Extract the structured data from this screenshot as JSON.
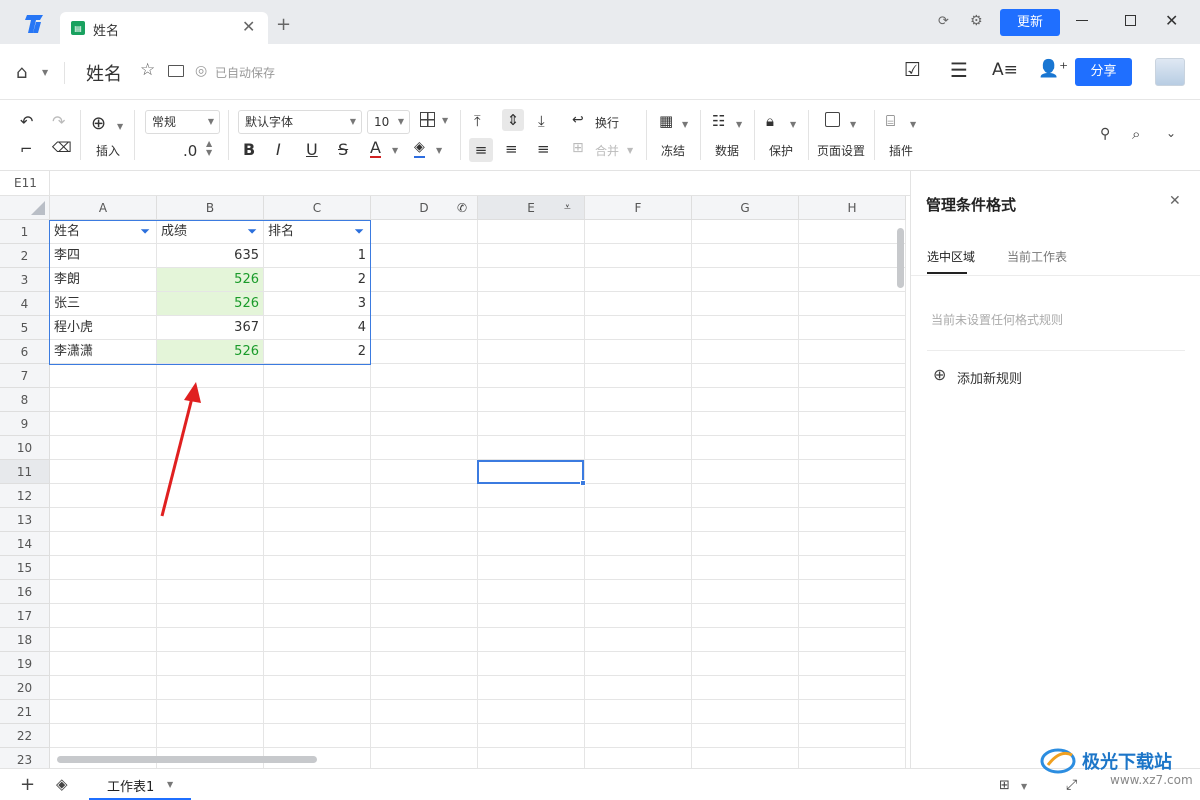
{
  "tabbar": {
    "doc_tab_title": "姓名",
    "new_tab": "+",
    "update_label": "更新"
  },
  "header": {
    "doc_title": "姓名",
    "autosave_text": "已自动保存",
    "share_label": "分享"
  },
  "toolbar": {
    "insert_label": "插入",
    "number_format": "常规",
    "decimal": ".0",
    "font_name": "默认字体",
    "font_size": "10",
    "wrap_label": "换行",
    "merge_label": "合并",
    "freeze_label": "冻结",
    "data_label": "数据",
    "protect_label": "保护",
    "page_setup_label": "页面设置",
    "plugin_label": "插件"
  },
  "formula": {
    "cell_ref": "E11"
  },
  "columns": [
    "A",
    "B",
    "C",
    "D",
    "E",
    "F",
    "G",
    "H"
  ],
  "rows": [
    "1",
    "2",
    "3",
    "4",
    "5",
    "6",
    "7",
    "8",
    "9",
    "10",
    "11",
    "12",
    "13",
    "14",
    "15",
    "16",
    "17",
    "18",
    "19",
    "20",
    "21",
    "22",
    "23"
  ],
  "table": {
    "headers": [
      "姓名",
      "成绩",
      "排名"
    ],
    "rows": [
      {
        "name": "李四",
        "score": "635",
        "rank": "1",
        "highlight": false
      },
      {
        "name": "李朗",
        "score": "526",
        "rank": "2",
        "highlight": true
      },
      {
        "name": "张三",
        "score": "526",
        "rank": "3",
        "highlight": true
      },
      {
        "name": "程小虎",
        "score": "367",
        "rank": "4",
        "highlight": false
      },
      {
        "name": "李潇潇",
        "score": "526",
        "rank": "2",
        "highlight": true
      }
    ]
  },
  "panel": {
    "title": "管理条件格式",
    "tab_selection": "选中区域",
    "tab_sheet": "当前工作表",
    "empty_text": "当前未设置任何格式规则",
    "add_rule": "添加新规则"
  },
  "bottom": {
    "sheet_tab": "工作表1",
    "watermark_cn": "极光下载站",
    "watermark_url": "www.xz7.com"
  },
  "colors": {
    "accent": "#1f6fff",
    "highlight_bg": "#e4f5d9",
    "highlight_text": "#1a9b2a",
    "arrow": "#e02020"
  }
}
